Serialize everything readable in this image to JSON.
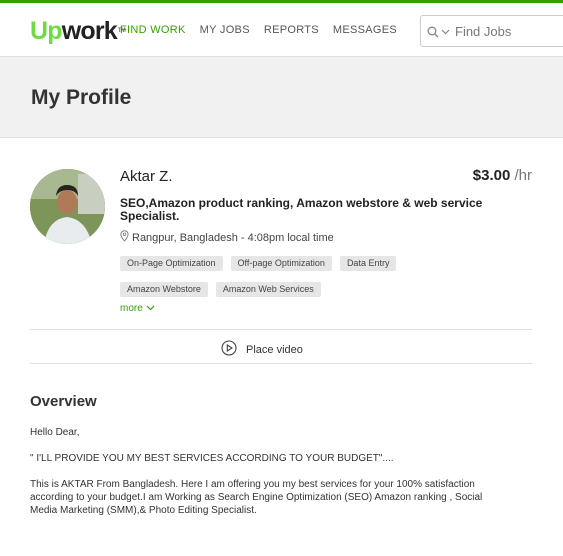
{
  "brand": {
    "up": "Up",
    "work": "work",
    "tm": "TM"
  },
  "nav": [
    {
      "label": "FIND WORK",
      "active": true
    },
    {
      "label": "MY JOBS",
      "active": false
    },
    {
      "label": "REPORTS",
      "active": false
    },
    {
      "label": "MESSAGES",
      "active": false
    }
  ],
  "search": {
    "placeholder": "Find Jobs",
    "icon": "search-icon"
  },
  "page": {
    "title": "My Profile"
  },
  "profile": {
    "name": "Aktar Z.",
    "rate_amount": "$3.00",
    "rate_unit": "/hr",
    "headline": "SEO,Amazon product ranking, Amazon webstore & web service Specialist.",
    "location": "Rangpur, Bangladesh - 4:08pm local time",
    "skills": [
      "On-Page Optimization",
      "Off-page Optimization",
      "Data Entry",
      "Amazon Webstore",
      "Amazon Web Services"
    ],
    "more_label": "more",
    "video_label": "Place video"
  },
  "overview": {
    "title": "Overview",
    "paragraphs": [
      "Hello Dear,",
      "\" I'LL PROVIDE YOU MY BEST SERVICES ACCORDING TO YOUR BUDGET\"....",
      "This is AKTAR From Bangladesh. Here I am offering you my best services for your 100% satisfaction according to your budget.I am Working as Search Engine Optimization (SEO) Amazon ranking , Social Media Marketing (SMM),& Photo Editing Specialist."
    ]
  },
  "colors": {
    "accent": "#37a000",
    "brand_green": "#6fda44",
    "tag_bg": "#e6e6e6"
  }
}
